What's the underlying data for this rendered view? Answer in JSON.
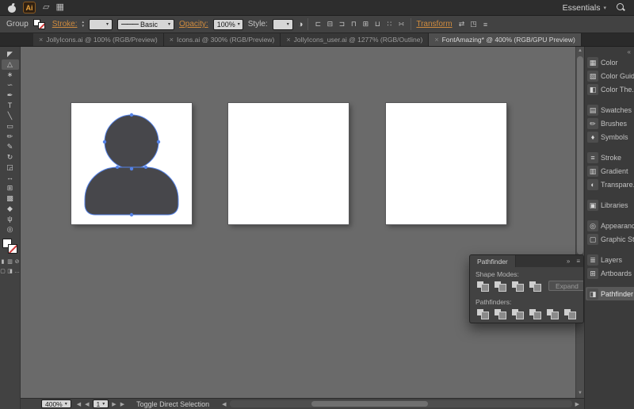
{
  "colors": {
    "link_orange": "#cf8b3e",
    "selection_blue": "#5583e8",
    "avatar_fill": "#47474b",
    "canvas_gray": "#6a6a6a",
    "none_red": "#d23a3a"
  },
  "glyphs": {
    "chevron_down": "▾",
    "chevron_up": "▴",
    "close": "×",
    "collapse_left": "«",
    "collapse_right": "»",
    "menu": "≡",
    "arrow_up": "▲",
    "arrow_down": "▼",
    "arrow_left": "◀",
    "arrow_right": "▶",
    "stroke_preview": "———"
  },
  "menubar": {
    "app_badge": "Ai",
    "workspace_label": "Essentials",
    "apple_icon_shape": "css-apple",
    "search_icon_shape": "css-magnifier",
    "icons": [
      {
        "name": "bridge-icon",
        "glyph": "▱"
      },
      {
        "name": "arrange-documents-icon",
        "glyph": "▦"
      }
    ]
  },
  "controlbar": {
    "selection_label": "Group",
    "stroke_label": "Stroke:",
    "brush_label": "Basic",
    "opacity_label": "Opacity:",
    "opacity_value": "100%",
    "style_label": "Style:",
    "transform_label": "Transform",
    "recolor_glyph": "◑",
    "align_icons": [
      {
        "name": "align-left-icon",
        "glyph": "⊏"
      },
      {
        "name": "align-center-icon",
        "glyph": "⊟"
      },
      {
        "name": "align-right-icon",
        "glyph": "⊐"
      },
      {
        "name": "align-top-icon",
        "glyph": "⊓"
      },
      {
        "name": "align-middle-icon",
        "glyph": "⊞"
      },
      {
        "name": "align-bottom-icon",
        "glyph": "⊔"
      },
      {
        "name": "distribute-horizontal-icon",
        "glyph": "∷"
      },
      {
        "name": "distribute-vertical-icon",
        "glyph": "∺"
      }
    ],
    "right_icons": [
      {
        "name": "shuffle-icon",
        "glyph": "⇄"
      },
      {
        "name": "isolate-icon",
        "glyph": "◳"
      },
      {
        "name": "panel-menu-icon",
        "glyph": "≡"
      }
    ]
  },
  "tabs": [
    {
      "close": "×",
      "label": "JollyIcons.ai @ 100% (RGB/Preview)",
      "active": false
    },
    {
      "close": "×",
      "label": "Icons.ai @ 300% (RGB/Preview)",
      "active": false
    },
    {
      "close": "×",
      "label": "JollyIcons_user.ai @ 1277% (RGB/Outline)",
      "active": false
    },
    {
      "close": "×",
      "label": "FontAmazing* @ 400% (RGB/GPU Preview)",
      "active": true
    }
  ],
  "toolbar": {
    "tools": [
      {
        "name": "selection-tool",
        "glyph": "◤"
      },
      {
        "name": "direct-selection-tool",
        "glyph": "△",
        "active": true
      },
      {
        "name": "magic-wand-tool",
        "glyph": "∗"
      },
      {
        "name": "lasso-tool",
        "glyph": "∽"
      },
      {
        "name": "pen-tool",
        "glyph": "✒"
      },
      {
        "name": "type-tool",
        "glyph": "T"
      },
      {
        "name": "line-segment-tool",
        "glyph": "╲"
      },
      {
        "name": "rectangle-tool",
        "glyph": "▭"
      },
      {
        "name": "paintbrush-tool",
        "glyph": "✏"
      },
      {
        "name": "pencil-tool",
        "glyph": "✎"
      },
      {
        "name": "rotate-tool",
        "glyph": "↻"
      },
      {
        "name": "scale-tool",
        "glyph": "◲"
      },
      {
        "name": "width-tool",
        "glyph": "↔"
      },
      {
        "name": "shape-builder-tool",
        "glyph": "⊞"
      },
      {
        "name": "gradient-tool",
        "glyph": "▩"
      },
      {
        "name": "eyedropper-tool",
        "glyph": "◆"
      },
      {
        "name": "hand-tool",
        "glyph": "ψ"
      },
      {
        "name": "zoom-tool",
        "glyph": "◎"
      }
    ],
    "small_buttons": [
      {
        "name": "color-button",
        "glyph": "▮"
      },
      {
        "name": "gradient-button",
        "glyph": "▥"
      },
      {
        "name": "none-button",
        "glyph": "⊘"
      }
    ],
    "mode_buttons": [
      {
        "name": "draw-mode-button",
        "glyph": "▢"
      },
      {
        "name": "screen-mode-button",
        "glyph": "◨"
      },
      {
        "name": "edit-toolbar-button",
        "glyph": "…"
      }
    ]
  },
  "dock": {
    "items": [
      {
        "name": "panel-color",
        "glyph": "▦",
        "label": "Color"
      },
      {
        "name": "panel-color-guide",
        "glyph": "▧",
        "label": "Color Guide"
      },
      {
        "name": "panel-color-themes",
        "glyph": "◧",
        "label": "Color The..."
      },
      {
        "name": "panel-swatches",
        "glyph": "▤",
        "label": "Swatches",
        "gap": true
      },
      {
        "name": "panel-brushes",
        "glyph": "✏",
        "label": "Brushes"
      },
      {
        "name": "panel-symbols",
        "glyph": "♦",
        "label": "Symbols"
      },
      {
        "name": "panel-stroke",
        "glyph": "≡",
        "label": "Stroke",
        "gap": true
      },
      {
        "name": "panel-gradient",
        "glyph": "▥",
        "label": "Gradient"
      },
      {
        "name": "panel-transparency",
        "glyph": "◐",
        "label": "Transpare..."
      },
      {
        "name": "panel-libraries",
        "glyph": "▣",
        "label": "Libraries",
        "gap": true
      },
      {
        "name": "panel-appearance",
        "glyph": "◎",
        "label": "Appearance",
        "gap": true
      },
      {
        "name": "panel-graphic-styles",
        "glyph": "▢",
        "label": "Graphic St..."
      },
      {
        "name": "panel-layers",
        "glyph": "≣",
        "label": "Layers",
        "gap": true
      },
      {
        "name": "panel-artboards",
        "glyph": "⊞",
        "label": "Artboards"
      },
      {
        "name": "panel-pathfinder",
        "glyph": "◨",
        "label": "Pathfinder",
        "active": true,
        "gap": true
      }
    ]
  },
  "pathfinder": {
    "title": "Pathfinder",
    "shape_modes_label": "Shape Modes:",
    "expand_button": "Expand",
    "pathfinders_label": "Pathfinders:",
    "shape_mode_buttons": [
      {
        "name": "unite-button"
      },
      {
        "name": "minus-front-button"
      },
      {
        "name": "intersect-button"
      },
      {
        "name": "exclude-button"
      }
    ],
    "pathfinder_buttons": [
      {
        "name": "divide-button"
      },
      {
        "name": "trim-button"
      },
      {
        "name": "merge-button"
      },
      {
        "name": "crop-button"
      },
      {
        "name": "outline-button"
      },
      {
        "name": "minus-back-button"
      }
    ]
  },
  "statusbar": {
    "zoom_value": "400%",
    "artboard_value": "1",
    "status_text": "Toggle Direct Selection"
  }
}
